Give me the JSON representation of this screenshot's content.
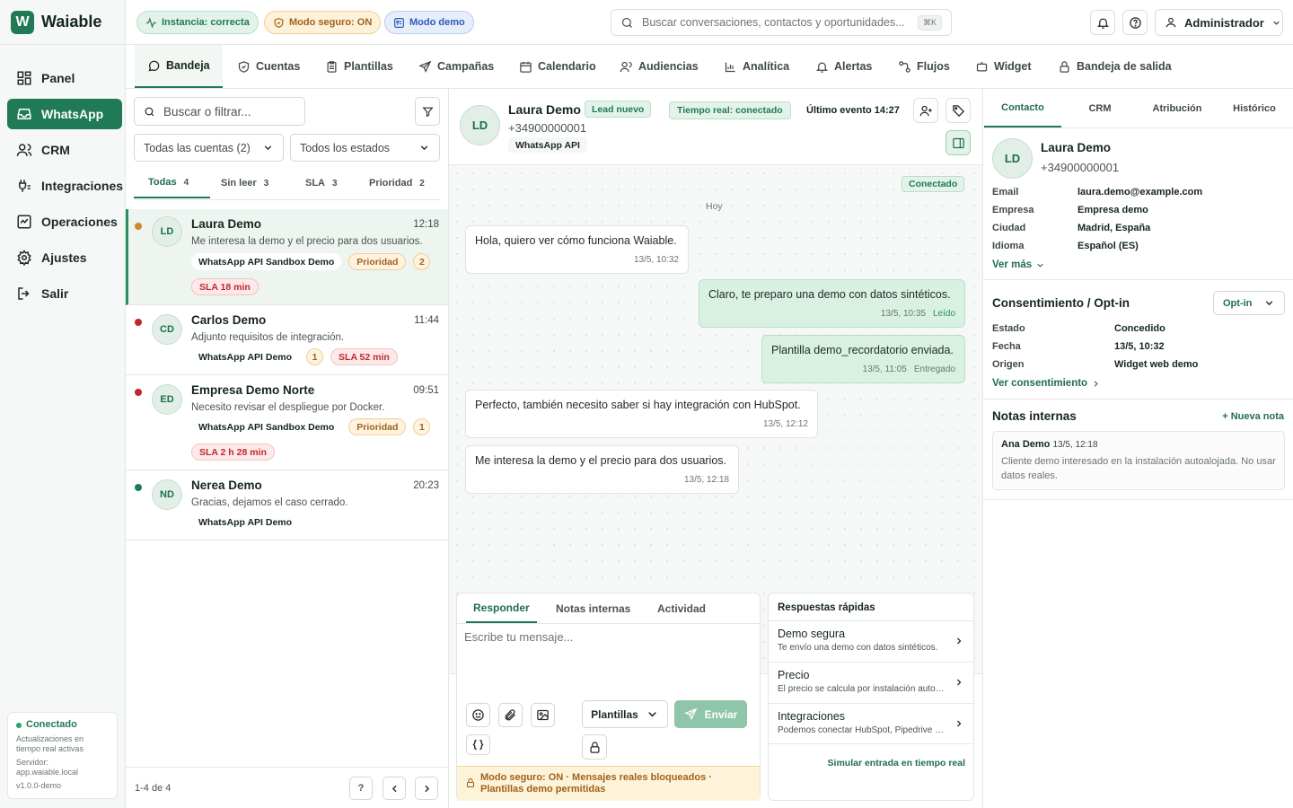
{
  "app": {
    "logo_letter": "W",
    "name": "Waiable"
  },
  "sidebar": {
    "items": [
      {
        "label": "Panel",
        "icon": "grid-icon"
      },
      {
        "label": "WhatsApp",
        "icon": "inbox-icon"
      },
      {
        "label": "CRM",
        "icon": "users-icon"
      },
      {
        "label": "Integraciones",
        "icon": "plug-icon"
      },
      {
        "label": "Operaciones",
        "icon": "activity-icon"
      },
      {
        "label": "Ajustes",
        "icon": "gear-icon"
      },
      {
        "label": "Salir",
        "icon": "logout-icon"
      }
    ],
    "status": {
      "title": "Conectado",
      "desc": "Actualizaciones en tiempo real activas",
      "server_label": "Servidor:",
      "server": "app.waiable.local",
      "version": "v1.0.0-demo"
    }
  },
  "topbar": {
    "pills": [
      {
        "label": "Instancia: correcta",
        "color": "#1f7a55"
      },
      {
        "label": "Modo seguro: ON",
        "color": "#a0621c"
      },
      {
        "label": "Modo demo",
        "color": "#2f5bb7"
      }
    ],
    "search_placeholder": "Buscar conversaciones, contactos y oportunidades...",
    "search_shortcut": "⌘K",
    "user": "Administrador"
  },
  "tabs": [
    {
      "label": "Bandeja",
      "icon": "chat-icon"
    },
    {
      "label": "Cuentas",
      "icon": "shield-icon"
    },
    {
      "label": "Plantillas",
      "icon": "clipboard-icon"
    },
    {
      "label": "Campañas",
      "icon": "send-icon"
    },
    {
      "label": "Calendario",
      "icon": "calendar-icon"
    },
    {
      "label": "Audiencias",
      "icon": "audience-icon"
    },
    {
      "label": "Analítica",
      "icon": "chart-icon"
    },
    {
      "label": "Alertas",
      "icon": "bell-icon"
    },
    {
      "label": "Flujos",
      "icon": "flow-icon"
    },
    {
      "label": "Widget",
      "icon": "widget-icon"
    },
    {
      "label": "Bandeja de salida",
      "icon": "lock-icon"
    }
  ],
  "inbox": {
    "filter_placeholder": "Buscar o filtrar...",
    "accounts_select": "Todas las cuentas (2)",
    "status_select": "Todos los estados",
    "subtabs": [
      {
        "label": "Todas",
        "count": "4"
      },
      {
        "label": "Sin leer",
        "count": "3"
      },
      {
        "label": "SLA",
        "count": "3"
      },
      {
        "label": "Prioridad",
        "count": "2"
      }
    ],
    "conversations": [
      {
        "initials": "LD",
        "name": "Laura Demo",
        "time": "12:18",
        "preview": "Me interesa la demo y el precio para dos usuarios.",
        "account": "WhatsApp API Sandbox Demo",
        "priority": "Prioridad",
        "count": "2",
        "sla": "SLA 18 min",
        "dot": "#c98a2a"
      },
      {
        "initials": "CD",
        "name": "Carlos Demo",
        "time": "11:44",
        "preview": "Adjunto requisitos de integración.",
        "account": "WhatsApp API Demo",
        "count": "1",
        "sla": "SLA 52 min",
        "dot": "#c0282d"
      },
      {
        "initials": "ED",
        "name": "Empresa Demo Norte",
        "time": "09:51",
        "preview": "Necesito revisar el despliegue por Docker.",
        "account": "WhatsApp API Sandbox Demo",
        "priority": "Prioridad",
        "count": "1",
        "sla": "SLA 2 h 28 min",
        "dot": "#c0282d"
      },
      {
        "initials": "ND",
        "name": "Nerea Demo",
        "time": "20:23",
        "preview": "Gracias, dejamos el caso cerrado.",
        "account": "WhatsApp API Demo",
        "dot": "#1f7a55"
      }
    ],
    "pager": {
      "range": "1-4 de 4",
      "help": "?"
    }
  },
  "chat": {
    "initials": "LD",
    "name": "Laura Demo",
    "badge": "Lead nuevo",
    "phone": "+34900000001",
    "channel": "WhatsApp API",
    "realtime": "Tiempo real: conectado",
    "last_event": "Último evento 14:27",
    "connected_badge": "Conectado",
    "day": "Hoy",
    "messages": [
      {
        "dir": "in",
        "text": "Hola, quiero ver cómo funciona Waiable.",
        "time": "13/5, 10:32",
        "status": ""
      },
      {
        "dir": "out",
        "text": "Claro, te preparo una demo con datos sintéticos.",
        "time": "13/5, 10:35",
        "status": "Leído"
      },
      {
        "dir": "out",
        "text": "Plantilla demo_recordatorio enviada.",
        "time": "13/5, 11:05",
        "status": "Entregado"
      },
      {
        "dir": "in",
        "text": "Perfecto, también necesito saber si hay integración con HubSpot.",
        "time": "13/5, 12:12",
        "status": ""
      },
      {
        "dir": "in",
        "text": "Me interesa la demo y el precio para dos usuarios.",
        "time": "13/5, 12:18",
        "status": ""
      }
    ],
    "composer": {
      "tabs": [
        "Responder",
        "Notas internas",
        "Actividad"
      ],
      "placeholder": "Escribe tu mensaje...",
      "templates": "Plantillas",
      "send": "Enviar",
      "safe_mode": "Modo seguro: ON · Mensajes reales bloqueados · Plantillas demo permitidas"
    },
    "quick": {
      "title": "Respuestas rápidas",
      "items": [
        {
          "title": "Demo segura",
          "desc": "Te envío una demo con datos sintéticos."
        },
        {
          "title": "Precio",
          "desc": "El precio se calcula por instalación autoalojada."
        },
        {
          "title": "Integraciones",
          "desc": "Podemos conectar HubSpot, Pipedrive y más."
        }
      ],
      "simulate": "Simular entrada en tiempo real"
    }
  },
  "contact": {
    "tabs": [
      "Contacto",
      "CRM",
      "Atribución",
      "Histórico"
    ],
    "initials": "LD",
    "name": "Laura Demo",
    "phone": "+34900000001",
    "fields": [
      {
        "k": "Email",
        "v": "laura.demo@example.com"
      },
      {
        "k": "Empresa",
        "v": "Empresa demo"
      },
      {
        "k": "Ciudad",
        "v": "Madrid, España"
      },
      {
        "k": "Idioma",
        "v": "Español (ES)"
      }
    ],
    "more": "Ver más",
    "consent": {
      "title": "Consentimiento / Opt-in",
      "select": "Opt-in",
      "fields": [
        {
          "k": "Estado",
          "v": "Concedido"
        },
        {
          "k": "Fecha",
          "v": "13/5, 10:32"
        },
        {
          "k": "Origen",
          "v": "Widget web demo"
        }
      ],
      "link": "Ver consentimiento"
    },
    "notes": {
      "title": "Notas internas",
      "new": "+ Nueva nota",
      "author": "Ana Demo",
      "time": "13/5, 12:18",
      "text": "Cliente demo interesado en la instalación autoalojada. No usar datos reales."
    }
  },
  "colors": {
    "accent": "#1f7a55",
    "warning": "#a0621c",
    "danger": "#c0282d",
    "info": "#2f5bb7"
  }
}
